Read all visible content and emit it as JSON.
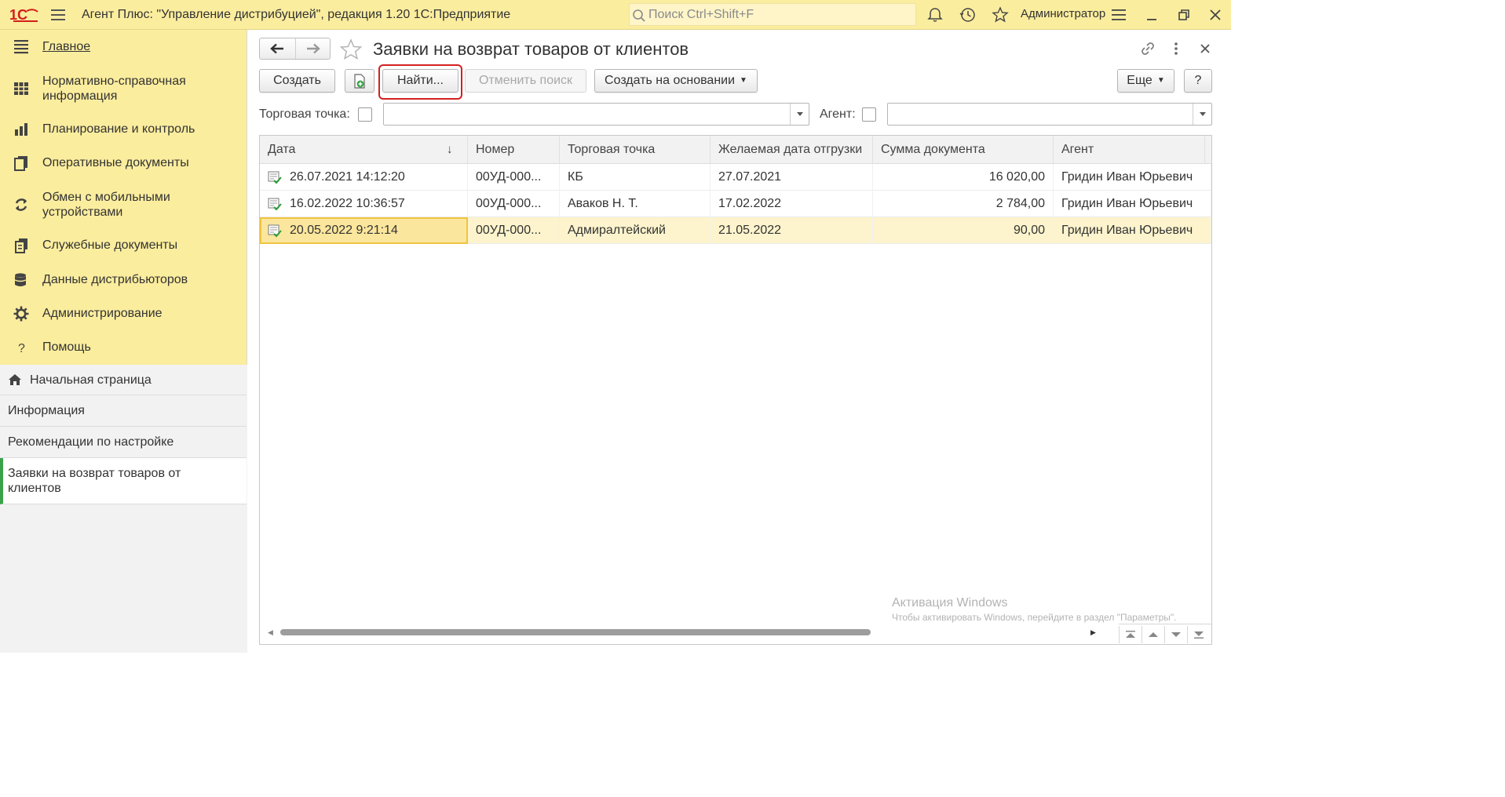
{
  "app": {
    "title": "Агент Плюс: \"Управление дистрибуцией\", редакция 1.20 1С:Предприятие",
    "search_placeholder": "Поиск Ctrl+Shift+F",
    "user": "Администратор"
  },
  "sidebar": {
    "sections": [
      {
        "label": "Главное",
        "icon": "menu-lines-icon"
      },
      {
        "label": "Нормативно-справочная информация",
        "icon": "catalog-grid-icon"
      },
      {
        "label": "Планирование и контроль",
        "icon": "bar-chart-icon"
      },
      {
        "label": "Оперативные документы",
        "icon": "documents-icon"
      },
      {
        "label": "Обмен с мобильными устройствами",
        "icon": "sync-icon"
      },
      {
        "label": "Служебные документы",
        "icon": "service-docs-icon"
      },
      {
        "label": "Данные дистрибьюторов",
        "icon": "database-icon"
      },
      {
        "label": "Администрирование",
        "icon": "gear-icon"
      },
      {
        "label": "Помощь",
        "icon": "question-icon"
      }
    ],
    "open_windows": [
      {
        "label": "Начальная страница",
        "icon": "home-icon"
      },
      {
        "label": "Информация"
      },
      {
        "label": "Рекомендации по настройке"
      },
      {
        "label": "Заявки на возврат товаров от клиентов"
      }
    ]
  },
  "form": {
    "title": "Заявки на возврат товаров от клиентов",
    "buttons": {
      "create": "Создать",
      "find": "Найти...",
      "cancel_search": "Отменить поиск",
      "create_based_on": "Создать на основании",
      "more": "Еще",
      "help": "?"
    },
    "filters": {
      "outlet_label": "Торговая точка:",
      "outlet_value": "",
      "agent_label": "Агент:",
      "agent_value": ""
    }
  },
  "table": {
    "columns": [
      "Дата",
      "Номер",
      "Торговая точка",
      "Желаемая дата отгрузки",
      "Сумма документа",
      "Агент"
    ],
    "sort_indicator": "↓",
    "rows": [
      {
        "date": "26.07.2021 14:12:20",
        "number": "00УД-000...",
        "outlet": "КБ",
        "ship_date": "27.07.2021",
        "sum": "16 020,00",
        "agent": "Гридин Иван Юрьевич"
      },
      {
        "date": "16.02.2022 10:36:57",
        "number": "00УД-000...",
        "outlet": "Аваков Н. Т.",
        "ship_date": "17.02.2022",
        "sum": "2 784,00",
        "agent": "Гридин Иван Юрьевич"
      },
      {
        "date": "20.05.2022 9:21:14",
        "number": "00УД-000...",
        "outlet": "Адмиралтейский",
        "ship_date": "21.05.2022",
        "sum": "90,00",
        "agent": "Гридин Иван Юрьевич",
        "selected": true
      }
    ]
  },
  "watermark": {
    "line1": "Активация Windows",
    "line2": "Чтобы активировать Windows, перейдите в раздел \"Параметры\"."
  },
  "colors": {
    "panel_yellow": "#fbed9e",
    "selection": "#fdf4cd",
    "highlight_red": "#d42020",
    "active_green": "#3aa34a"
  }
}
